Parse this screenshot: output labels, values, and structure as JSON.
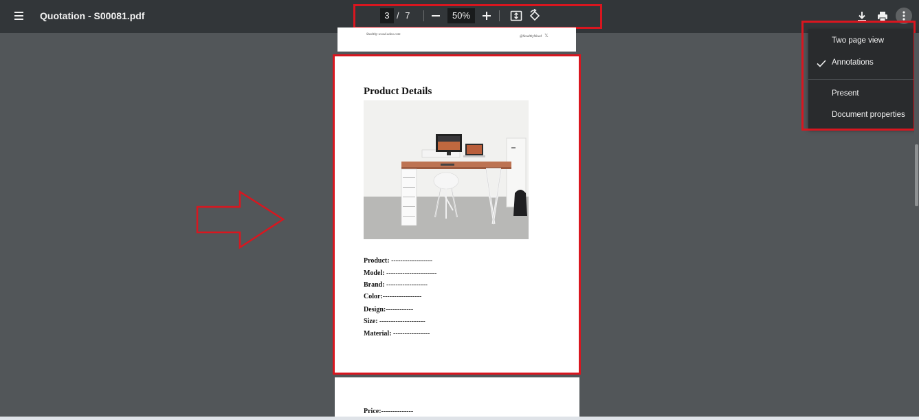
{
  "toolbar": {
    "title": "Quotation - S00081.pdf",
    "current_page": "3",
    "page_separator": "/",
    "total_pages": "7",
    "zoom": "50%"
  },
  "icons": {
    "menu": "hamburger-menu-icon",
    "zoom_out": "minus-icon",
    "zoom_in": "plus-icon",
    "fit": "fit-to-page-icon",
    "rotate": "rotate-icon",
    "download": "download-icon",
    "print": "print-icon",
    "more": "more-vert-icon"
  },
  "menu": {
    "items": [
      {
        "label": "Two page view",
        "checked": false
      },
      {
        "label": "Annotations",
        "checked": true
      },
      {
        "label": "Present",
        "checked": false
      },
      {
        "label": "Document properties",
        "checked": false
      }
    ]
  },
  "prev_page": {
    "footer_left": "Stealthy-wood.odoo.com",
    "footer_right": "@StealthyWood"
  },
  "document": {
    "heading": "Product Details",
    "specs": [
      "Product: ------------------",
      "Model: ----------------------",
      "Brand: ------------------",
      "Color:-----------------",
      "Design:------------",
      "Size: --------------------",
      "Material: ----------------"
    ]
  },
  "next_page": {
    "price": "Price:--------------"
  },
  "colors": {
    "toolbar_bg": "#323639",
    "viewer_bg": "#525659",
    "highlight": "#d9161f",
    "menu_bg": "#292b2d"
  }
}
